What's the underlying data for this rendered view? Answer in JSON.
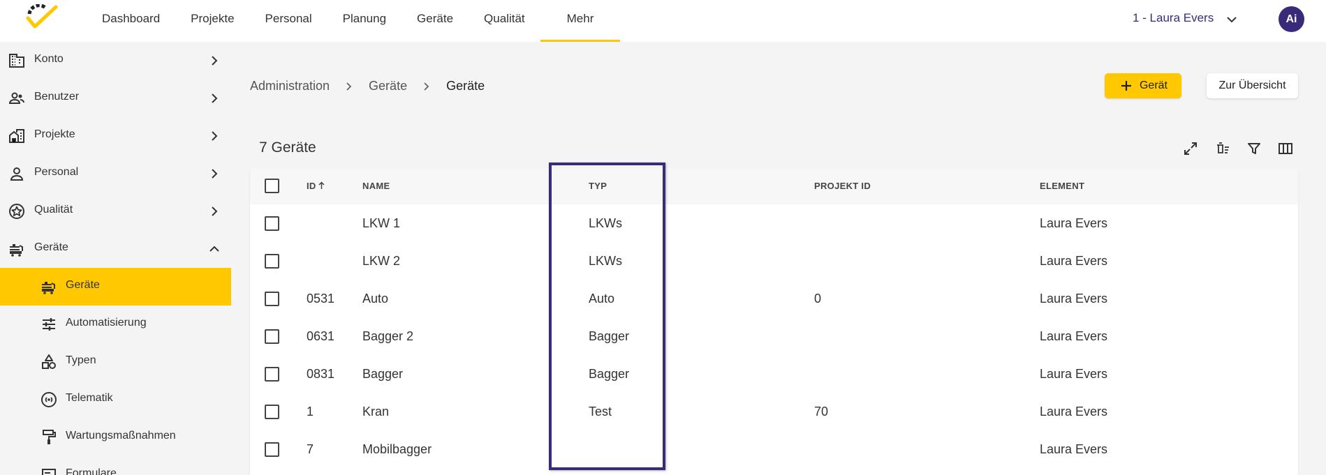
{
  "topnav": {
    "items": [
      {
        "label": "Dashboard"
      },
      {
        "label": "Projekte"
      },
      {
        "label": "Personal"
      },
      {
        "label": "Planung"
      },
      {
        "label": "Geräte"
      },
      {
        "label": "Qualität"
      },
      {
        "label": "Mehr"
      }
    ],
    "active_index": 6,
    "user_label": "1 - Laura Evers",
    "avatar_initials": "Ai"
  },
  "sidebar": {
    "items": [
      {
        "label": "Konto",
        "icon": "building-icon",
        "expandable": true,
        "expanded": false
      },
      {
        "label": "Benutzer",
        "icon": "users-icon",
        "expandable": true,
        "expanded": false
      },
      {
        "label": "Projekte",
        "icon": "house-building-icon",
        "expandable": true,
        "expanded": false
      },
      {
        "label": "Personal",
        "icon": "person-icon",
        "expandable": true,
        "expanded": false
      },
      {
        "label": "Qualität",
        "icon": "star-badge-icon",
        "expandable": true,
        "expanded": false
      },
      {
        "label": "Geräte",
        "icon": "equipment-icon",
        "expandable": true,
        "expanded": true
      }
    ],
    "subitems": [
      {
        "label": "Geräte",
        "icon": "equipment-icon",
        "active": true
      },
      {
        "label": "Automatisierung",
        "icon": "sliders-icon",
        "active": false
      },
      {
        "label": "Typen",
        "icon": "shapes-icon",
        "active": false
      },
      {
        "label": "Telematik",
        "icon": "signal-icon",
        "active": false
      },
      {
        "label": "Wartungsmaßnahmen",
        "icon": "paint-roller-icon",
        "active": false
      },
      {
        "label": "Formulare",
        "icon": "form-icon",
        "active": false
      }
    ]
  },
  "breadcrumb": [
    "Administration",
    "Geräte",
    "Geräte"
  ],
  "actions": {
    "add_label": "Gerät",
    "overview_label": "Zur Übersicht"
  },
  "table": {
    "title": "7 Geräte",
    "toolbar_icons": [
      "fullscreen-icon",
      "clear-filter-icon",
      "filter-icon",
      "columns-icon"
    ],
    "columns": [
      "ID",
      "NAME",
      "TYP",
      "PROJEKT ID",
      "ELEMENT"
    ],
    "sorted_column": "ID",
    "sort_direction": "ascending",
    "rows": [
      {
        "id": "",
        "name": "LKW 1",
        "typ": "LKWs",
        "projekt_id": "",
        "element": "Laura Evers"
      },
      {
        "id": "",
        "name": "LKW 2",
        "typ": "LKWs",
        "projekt_id": "",
        "element": "Laura Evers"
      },
      {
        "id": "0531",
        "name": "Auto",
        "typ": "Auto",
        "projekt_id": "0",
        "element": "Laura Evers"
      },
      {
        "id": "0631",
        "name": "Bagger 2",
        "typ": "Bagger",
        "projekt_id": "",
        "element": "Laura Evers"
      },
      {
        "id": "0831",
        "name": "Bagger",
        "typ": "Bagger",
        "projekt_id": "",
        "element": "Laura Evers"
      },
      {
        "id": "1",
        "name": "Kran",
        "typ": "Test",
        "projekt_id": "70",
        "element": "Laura Evers"
      },
      {
        "id": "7",
        "name": "Mobilbagger",
        "typ": "",
        "projekt_id": "",
        "element": "Laura Evers"
      }
    ]
  },
  "colors": {
    "accent": "#ffc800",
    "brand_purple": "#3a2a7a",
    "highlight_border": "#3a2a7a"
  }
}
